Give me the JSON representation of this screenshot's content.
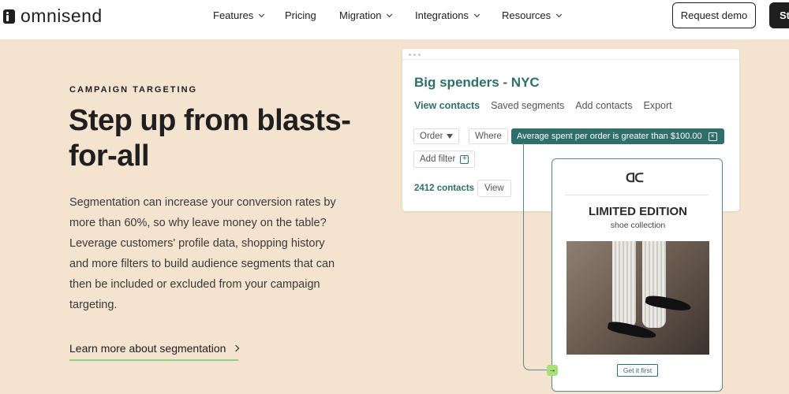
{
  "brand": {
    "name": "omnisend"
  },
  "nav": {
    "items": [
      {
        "label": "Features",
        "dropdown": true
      },
      {
        "label": "Pricing",
        "dropdown": false
      },
      {
        "label": "Migration",
        "dropdown": true
      },
      {
        "label": "Integrations",
        "dropdown": true
      },
      {
        "label": "Resources",
        "dropdown": true
      }
    ],
    "request_demo": "Request demo",
    "start": "St"
  },
  "hero": {
    "eyebrow": "CAMPAIGN TARGETING",
    "title": "Step up from blasts-for-all",
    "body": "Segmentation can increase your conversion rates by more than 60%, so why leave money on the table? Leverage customers' profile data, shopping history and more filters to build audience segments that can then be included or excluded from your campaign targeting.",
    "link": "Learn more about segmentation"
  },
  "segment_panel": {
    "title": "Big spenders - NYC",
    "tabs": [
      "View contacts",
      "Saved segments",
      "Add contacts",
      "Export"
    ],
    "active_tab": 0,
    "filter_chips": [
      "Order",
      "Where"
    ],
    "active_filter": "Average spent per order is greater than $100.00",
    "add_filter": "Add filter",
    "contacts_count": "2412 contacts",
    "view_button": "View"
  },
  "email_preview": {
    "brand_mark": "ᗡᑕ",
    "title": "LIMITED EDITION",
    "subtitle": "shoe collection",
    "cta": "Get it first"
  },
  "colors": {
    "background": "#f3e3cf",
    "accent_teal": "#2f6f69",
    "link_underline": "#8fd08a",
    "connector_node": "#a6e07a"
  },
  "icons": [
    "chevron-down-icon",
    "filter-icon",
    "close-box-icon",
    "plus-box-icon",
    "arrow-right-icon"
  ]
}
